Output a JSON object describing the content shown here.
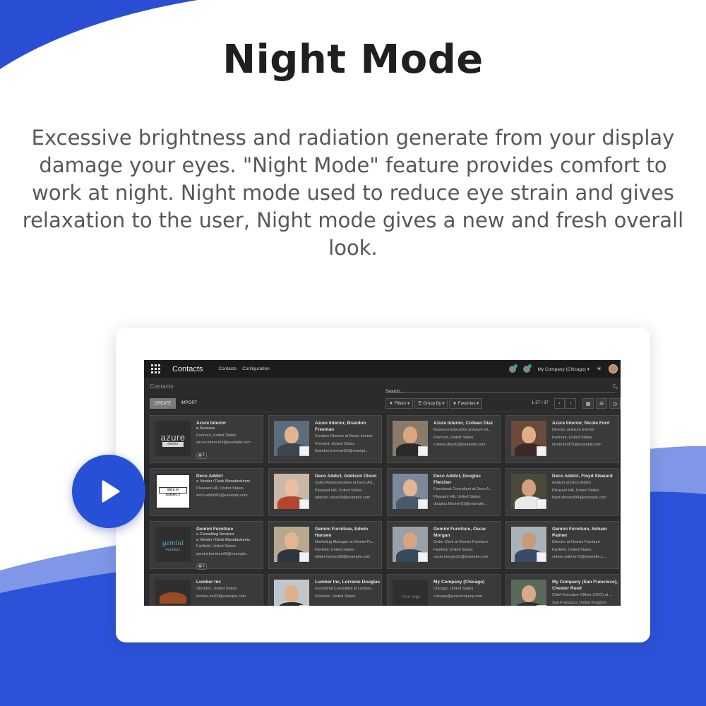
{
  "headline": "Night Mode",
  "description": "Excessive brightness and radiation generate from your display damage your eyes. \"Night Mode\" feature provides comfort to work at night. Night mode used to reduce eye strain and gives relaxation to the user, Night mode gives a new and fresh overall look.",
  "colors": {
    "accent_blue": "#2651d6",
    "app_bg": "#2b2b2b",
    "navbar_bg": "#1c1c1c",
    "card_bg": "#3a3a3a"
  },
  "play_button": {
    "icon": "play-icon"
  },
  "app": {
    "brand": "Contacts",
    "menu": [
      "Contacts",
      "Configuration"
    ],
    "company": "My Company (Chicago) ▾",
    "icons": [
      "apps-grid-icon",
      "chat-icon",
      "activity-icon",
      "sun-icon",
      "user-avatar"
    ],
    "breadcrumb": "Contacts",
    "search_placeholder": "Search...",
    "create_label": "CREATE",
    "import_label": "IMPORT",
    "filters_label": "Filters ▾",
    "groupby_label": "Group By ▾",
    "favorites_label": "Favorites ▾",
    "pager": "1-37 / 37",
    "contacts": [
      {
        "name": "Azure Interior",
        "tags": [
          "Services"
        ],
        "lines": [
          "Fremont, United States",
          "azure.Interior24@example.com"
        ],
        "meet": "1",
        "logo": "azure",
        "logo_text": "azure",
        "logo_sub": "interior"
      },
      {
        "name": "Azure Interior, Brandon Freeman",
        "lines": [
          "Creative Director at Azure Interior",
          "Fremont, United States",
          "brandon.freeman55@exampl..."
        ]
      },
      {
        "name": "Azure Interior, Colleen Diaz",
        "lines": [
          "Business Executive at Azure Int...",
          "Fremont, United States",
          "colleen.diaz83@example.com"
        ]
      },
      {
        "name": "Azure Interior, Nicole Ford",
        "lines": [
          "Director at Azure Interior",
          "Fremont, United States",
          "nicole.ford75@example.com"
        ]
      },
      {
        "name": "Deco Addict",
        "tags": [
          "Vendor / Desk Manufacturers"
        ],
        "lines": [
          "Pleasant Hill, United States",
          "deco.addict82@example.com"
        ],
        "logo": "deco",
        "logo_text": "DECO ADDICT"
      },
      {
        "name": "Deco Addict, Addison Olson",
        "lines": [
          "Sales Representative at Deco Ad...",
          "Pleasant Hill, United States",
          "addison.olson28@example.com"
        ]
      },
      {
        "name": "Deco Addict, Douglas Fletcher",
        "lines": [
          "Functional Consultant at Deco A...",
          "Pleasant Hill, United States",
          "douglas.fletcher51@example..."
        ]
      },
      {
        "name": "Deco Addict, Floyd Steward",
        "lines": [
          "Analyst at Deco Addict",
          "Pleasant Hill, United States",
          "floyd.steward34@example.com"
        ]
      },
      {
        "name": "Gemini Furniture",
        "tags": [
          "Consulting Services",
          "Vendor / Desk Manufacturers"
        ],
        "lines": [
          "Fairfield, United States",
          "gemini.furniture39@example..."
        ],
        "meet": "1",
        "logo": "gemini",
        "logo_text": "gemini",
        "logo_sub": "Furniture"
      },
      {
        "name": "Gemini Furniture, Edwin Hansen",
        "lines": [
          "Marketing Manager at Gemini Fu...",
          "Fairfield, United States",
          "edwin.hansen58@example.com"
        ]
      },
      {
        "name": "Gemini Furniture, Oscar Morgan",
        "lines": [
          "Order Clerk at Gemini Furniture",
          "Fairfield, United States",
          "oscar.morgan11@example.com"
        ]
      },
      {
        "name": "Gemini Furniture, Soham Palmer",
        "lines": [
          "Director at Gemini Furniture",
          "Fairfield, United States",
          "soham.palmer15@example.c..."
        ]
      },
      {
        "name": "Lumber Inc",
        "lines": [
          "Stockton, United States",
          "lumber-inv92@example.com"
        ],
        "logo": "lumber"
      },
      {
        "name": "Lumber Inc, Lorraine Douglas",
        "lines": [
          "Functional Consultant at Lumber...",
          "Stockton, United States"
        ]
      },
      {
        "name": "My Company (Chicago)",
        "lines": [
          "Chicago, United States",
          "chicago@yourcompany.com"
        ],
        "logo": "yourlogo",
        "logo_text": "Your logo"
      },
      {
        "name": "My Company (San Francisco), Chester Reed",
        "lines": [
          "Chief Executive Officer (CEO) at ...",
          "San Francisco, United Kingdom"
        ]
      }
    ]
  }
}
